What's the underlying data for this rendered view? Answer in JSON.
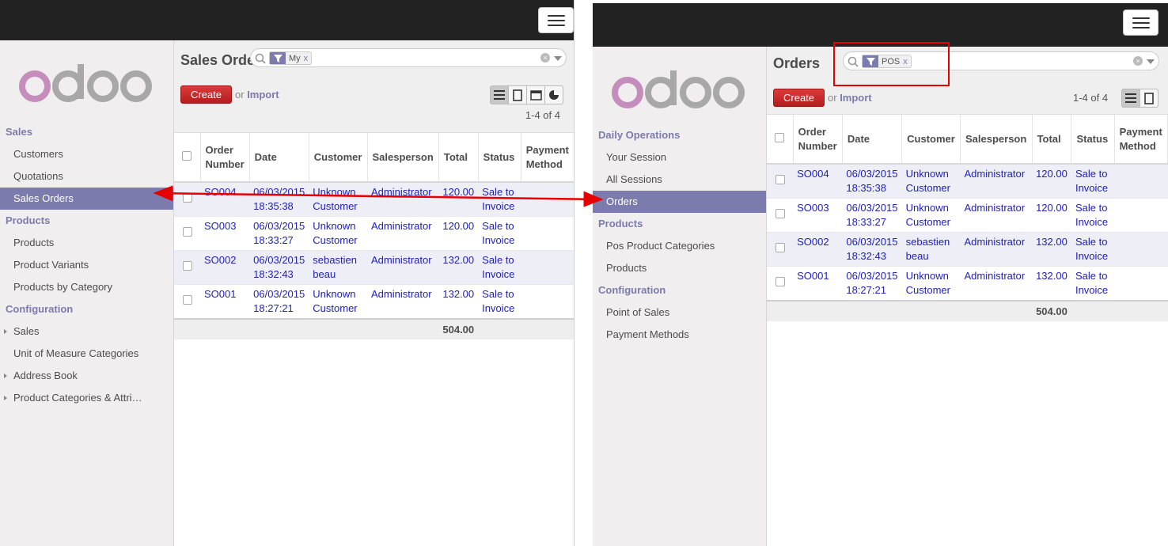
{
  "brand": {
    "logo_text": "odoo",
    "accent": "#7c7bad",
    "create_color": "#c82a2a",
    "highlight": "#e60000"
  },
  "left": {
    "sidebar": [
      {
        "type": "head",
        "label": "Sales"
      },
      {
        "type": "item",
        "label": "Customers"
      },
      {
        "type": "item",
        "label": "Quotations"
      },
      {
        "type": "item",
        "label": "Sales Orders",
        "active": true
      },
      {
        "type": "head",
        "label": "Products"
      },
      {
        "type": "item",
        "label": "Products"
      },
      {
        "type": "item",
        "label": "Product Variants"
      },
      {
        "type": "item",
        "label": "Products by Category"
      },
      {
        "type": "head",
        "label": "Configuration"
      },
      {
        "type": "item",
        "label": "Sales",
        "caret": true
      },
      {
        "type": "item",
        "label": "Unit of Measure Categories"
      },
      {
        "type": "item",
        "label": "Address Book",
        "caret": true
      },
      {
        "type": "item",
        "label": "Product Categories & Attri…",
        "caret": true
      }
    ],
    "title": "Sales Orde",
    "facet": "My",
    "facet_close": "x",
    "create_label": "Create",
    "or_text": "or",
    "import_label": "Import",
    "pager": "1-4 of 4",
    "views": [
      "list-view-icon",
      "form-view-icon",
      "calendar-view-icon",
      "graph-view-icon"
    ],
    "total": "504.00"
  },
  "right": {
    "sidebar": [
      {
        "type": "head",
        "label": "Daily Operations"
      },
      {
        "type": "item",
        "label": "Your Session"
      },
      {
        "type": "item",
        "label": "All Sessions"
      },
      {
        "type": "item",
        "label": "Orders",
        "active": true
      },
      {
        "type": "head",
        "label": "Products"
      },
      {
        "type": "item",
        "label": "Pos Product Categories"
      },
      {
        "type": "item",
        "label": "Products"
      },
      {
        "type": "head",
        "label": "Configuration"
      },
      {
        "type": "item",
        "label": "Point of Sales"
      },
      {
        "type": "item",
        "label": "Payment Methods"
      }
    ],
    "title": "Orders",
    "facet": "POS",
    "facet_close": "x",
    "create_label": "Create",
    "or_text": "or",
    "import_label": "Import",
    "pager": "1-4 of 4",
    "views": [
      "list-view-icon",
      "form-view-icon"
    ],
    "total": "504.00"
  },
  "table": {
    "headers": [
      "Order Number",
      "Date",
      "Customer",
      "Salesperson",
      "Total",
      "Status",
      "Payment Method"
    ],
    "rows": [
      {
        "number": "SO004",
        "date": "06/03/2015 18:35:38",
        "customer": "Unknown Customer",
        "salesperson": "Administrator",
        "total": "120.00",
        "status": "Sale to Invoice",
        "payment": ""
      },
      {
        "number": "SO003",
        "date": "06/03/2015 18:33:27",
        "customer": "Unknown Customer",
        "salesperson": "Administrator",
        "total": "120.00",
        "status": "Sale to Invoice",
        "payment": ""
      },
      {
        "number": "SO002",
        "date": "06/03/2015 18:32:43",
        "customer": "sebastien beau",
        "salesperson": "Administrator",
        "total": "132.00",
        "status": "Sale to Invoice",
        "payment": ""
      },
      {
        "number": "SO001",
        "date": "06/03/2015 18:27:21",
        "customer": "Unknown Customer",
        "salesperson": "Administrator",
        "total": "132.00",
        "status": "Sale to Invoice",
        "payment": ""
      }
    ]
  }
}
